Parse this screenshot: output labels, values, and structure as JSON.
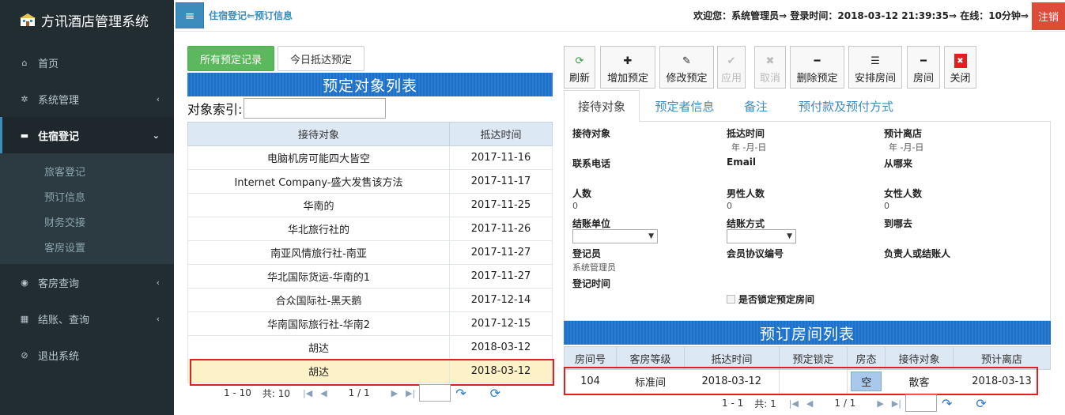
{
  "sidebar": {
    "brand": "方讯酒店管理系统",
    "items": [
      {
        "label": "首页",
        "icon": "home-icon"
      },
      {
        "label": "系统管理",
        "icon": "gear-icon"
      },
      {
        "label": "住宿登记",
        "icon": "bed-icon"
      },
      {
        "label": "客房查询",
        "icon": "eye-icon"
      },
      {
        "label": "结账、查询",
        "icon": "calculator-icon"
      },
      {
        "label": "退出系统",
        "icon": "ban-icon"
      }
    ],
    "subitems": [
      "旅客登记",
      "预订信息",
      "财务交接",
      "客房设置"
    ]
  },
  "header": {
    "breadcrumb": "住宿登记⇐预订信息",
    "welcome": "欢迎您：系统管理员⇒ 登录时间：2018-03-12 21:39:35⇒ 在线：10分钟⇒",
    "logout": "注销"
  },
  "left": {
    "tab_all": "所有预定记录",
    "tab_today": "今日抵达预定",
    "list_title": "预定对象列表",
    "index_label": "对象索引:",
    "columns": [
      "接待对象",
      "抵达时间"
    ],
    "rows": [
      [
        "电脑机房可能四大皆空",
        "2017-11-16"
      ],
      [
        "Internet Company-盛大发售该方法",
        "2017-11-17"
      ],
      [
        "华南的",
        "2017-11-25"
      ],
      [
        "华北旅行社的",
        "2017-11-26"
      ],
      [
        "南亚风情旅行社-南亚",
        "2017-11-27"
      ],
      [
        "华北国际货运-华南的1",
        "2017-11-27"
      ],
      [
        "合众国际社-黑天鹅",
        "2017-12-14"
      ],
      [
        "华南国际旅行社-华南2",
        "2017-12-15"
      ],
      [
        "胡达",
        "2018-03-12"
      ],
      [
        "胡达",
        "2018-03-12"
      ]
    ],
    "pager_range": "1 - 10",
    "pager_total": "共: 10",
    "pager_page": "1 / 1"
  },
  "toolbar": {
    "buttons": [
      {
        "label": "刷新",
        "icon": "refresh-icon",
        "color": "#2e9b3e"
      },
      {
        "label": "增加预定",
        "icon": "plus-icon",
        "color": "#222222"
      },
      {
        "label": "修改预定",
        "icon": "edit-icon",
        "color": "#555555"
      },
      {
        "label": "应用",
        "icon": "check-icon",
        "color": "#bbbbbb"
      },
      {
        "label": "取消",
        "icon": "x-icon",
        "color": "#bbbbbb"
      },
      {
        "label": "删除预定",
        "icon": "minus-icon",
        "color": "#222222"
      },
      {
        "label": "安排房间",
        "icon": "arrange-icon",
        "color": "#555555"
      },
      {
        "label": "房间",
        "icon": "minus-icon",
        "color": "#222222"
      },
      {
        "label": "关闭",
        "icon": "close-icon",
        "color": "#e02020"
      }
    ]
  },
  "form": {
    "tabs": [
      "接待对象",
      "预定者信息",
      "备注",
      "预付款及预付方式"
    ],
    "labels": {
      "guest": "接待对象",
      "arrival": "抵达时间",
      "departure": "预计离店",
      "phone": "联系电话",
      "email": "Email",
      "from": "从哪来",
      "people": "人数",
      "male": "男性人数",
      "female": "女性人数",
      "billing_unit": "结账单位",
      "billing_method": "结账方式",
      "destination": "到哪去",
      "registrar": "登记员",
      "member_no": "会员协议编号",
      "payer": "负责人或结账人",
      "reg_time": "登记时间",
      "lock_rooms": "是否锁定预定房间"
    },
    "values": {
      "arrival": "年 -月-日",
      "departure": "年 -月-日",
      "people": "0",
      "male": "0",
      "female": "0",
      "registrar": "系统管理员"
    }
  },
  "rooms": {
    "title": "预订房间列表",
    "columns": [
      "房间号",
      "客房等级",
      "抵达时间",
      "预定锁定",
      "房态",
      "接待对象",
      "预计离店"
    ],
    "rows": [
      [
        "104",
        "标准间",
        "2018-03-12",
        "",
        "空",
        "散客",
        "2018-03-13"
      ]
    ],
    "pager_range": "1 - 1",
    "pager_total": "共: 1",
    "pager_page": "1 / 1"
  }
}
